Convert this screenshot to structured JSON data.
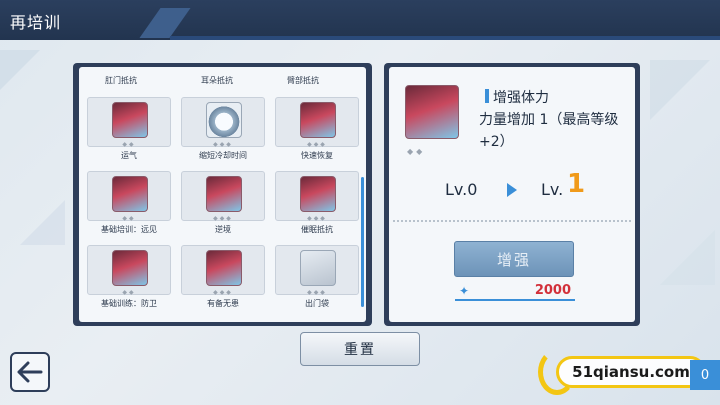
{
  "header": {
    "title": "再培训"
  },
  "grid": {
    "top_labels": [
      "肛门抵抗",
      "耳朵抵抗",
      "臂部抵抗"
    ],
    "cells": [
      {
        "label": "运气",
        "icon": "portrait-icon"
      },
      {
        "label": "缩短冷却时间",
        "icon": "stopwatch-icon"
      },
      {
        "label": "快速恢复",
        "icon": "portrait-icon"
      },
      {
        "label": "基础培训：远见",
        "icon": "portrait-icon"
      },
      {
        "label": "逆境",
        "icon": "portrait-icon"
      },
      {
        "label": "催眠抵抗",
        "icon": "portrait-icon"
      },
      {
        "label": "基础训练：防卫",
        "icon": "portrait-icon"
      },
      {
        "label": "有备无患",
        "icon": "portrait-icon"
      },
      {
        "label": "出门袋",
        "icon": "bag-icon"
      }
    ],
    "diamonds": [
      "◆◆",
      "◆◆◆",
      "◆◆◆",
      "◆◆",
      "◆◆◆",
      "◆◆◆",
      "◆◆",
      "◆◆◆",
      "◆◆◆"
    ]
  },
  "detail": {
    "skill_name": "增强体力",
    "description": "力量增加 1（最高等级 +2）",
    "diamonds": "◆◆",
    "level_from": "Lv.0",
    "level_to_prefix": "Lv.",
    "level_to_value": "1",
    "enhance_label": "增强",
    "cost": "2000"
  },
  "reset_label": "重置",
  "watermark": "51qiansu.com",
  "counter": "0",
  "colors": {
    "accent": "#3a8fd8",
    "level_highlight": "#f09a1a",
    "cost": "#d2303a",
    "header": "#2b3f5e"
  }
}
